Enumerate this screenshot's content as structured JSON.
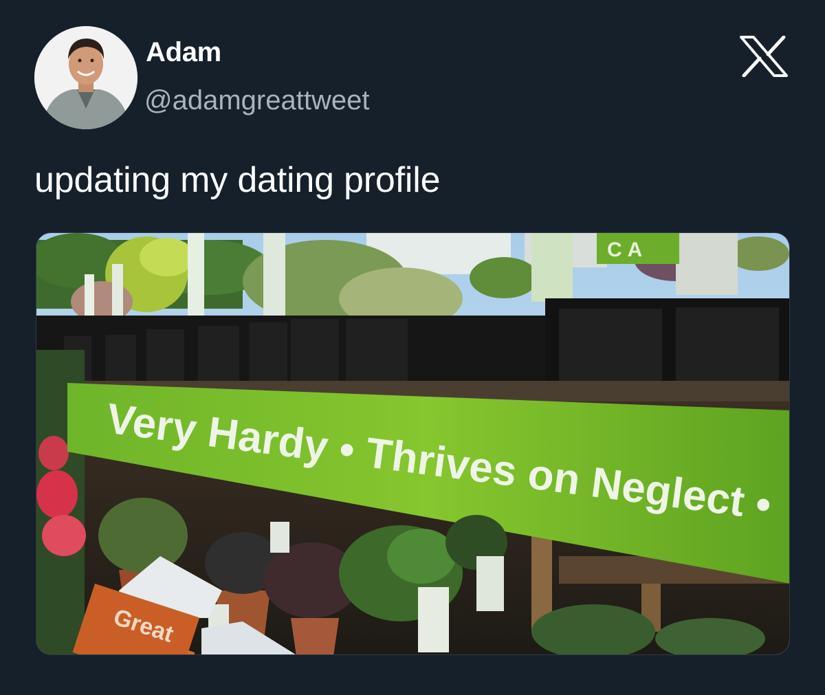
{
  "tweet": {
    "author": {
      "display_name": "Adam",
      "handle": "@adamgreattweet",
      "avatar_icon": "profile-photo"
    },
    "platform_icon": "x-logo-icon",
    "text": "updating my dating profile",
    "media": {
      "banner_text": "Very Hardy • Thrives on Neglect •",
      "crate_text": "Great",
      "tag_text": "CA",
      "banner_color": "#7ec12b"
    }
  },
  "colors": {
    "background": "#15202b",
    "primary_text": "#ffffff",
    "secondary_text": "#a8b3bd"
  }
}
